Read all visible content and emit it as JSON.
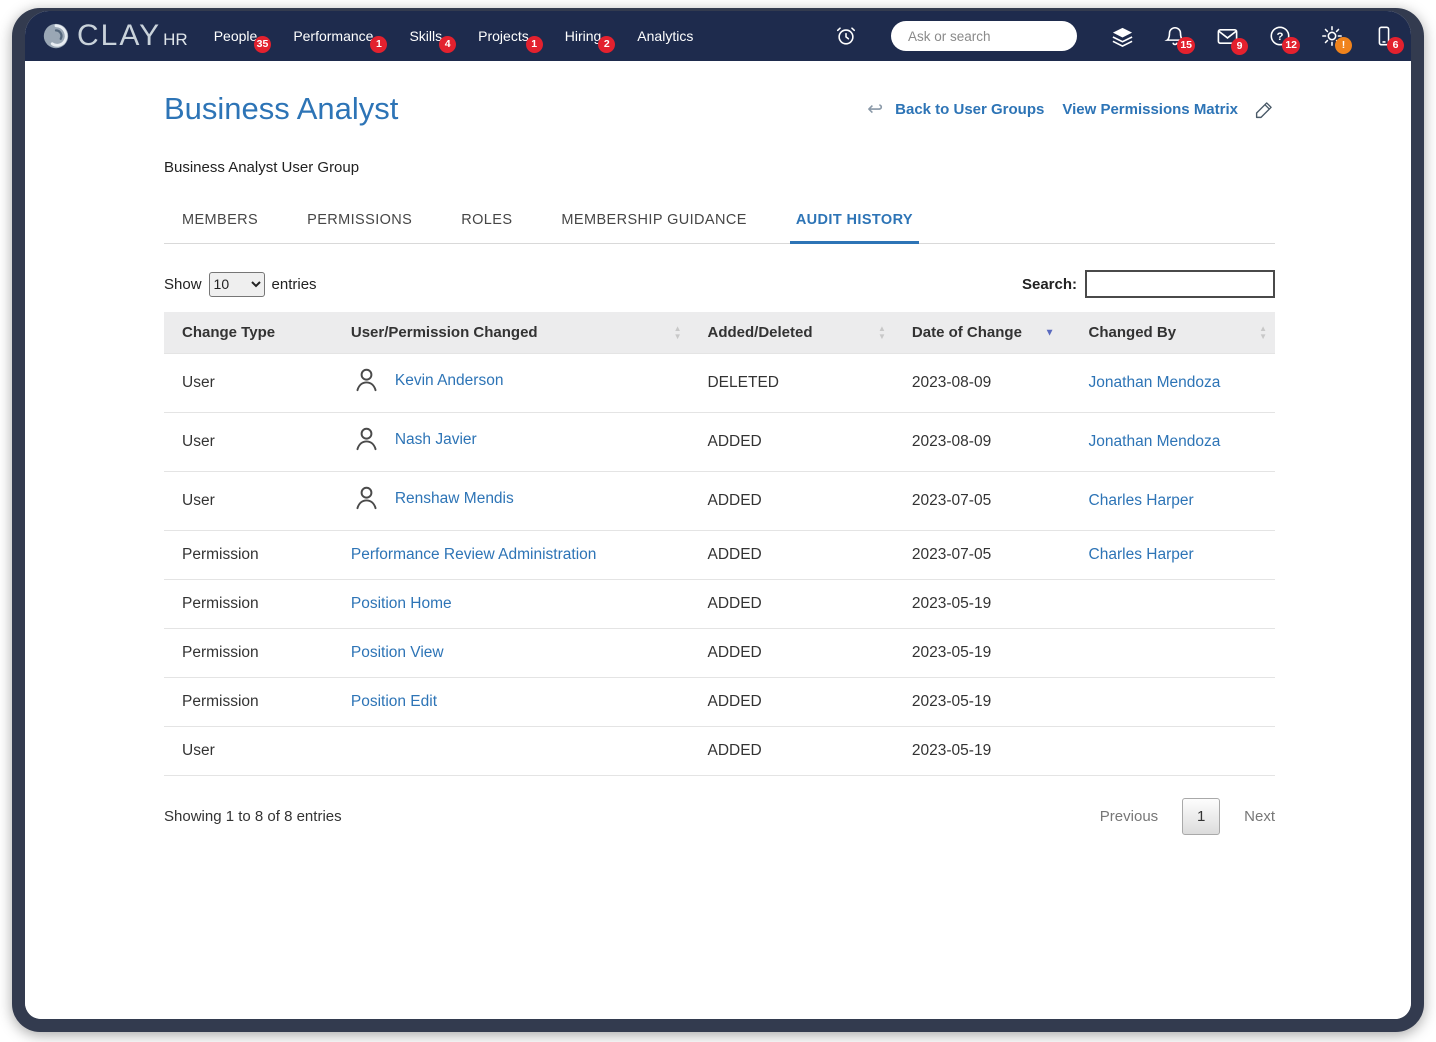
{
  "navbar": {
    "brand_primary": "CLAY",
    "brand_secondary": "HR",
    "items": [
      {
        "label": "People",
        "badge": "35"
      },
      {
        "label": "Performance",
        "badge": "1"
      },
      {
        "label": "Skills",
        "badge": "4"
      },
      {
        "label": "Projects",
        "badge": "1"
      },
      {
        "label": "Hiring",
        "badge": "2"
      },
      {
        "label": "Analytics",
        "badge": ""
      }
    ],
    "search": {
      "placeholder": "Ask or search"
    },
    "status_icons": [
      {
        "name": "clock-icon",
        "badge": ""
      },
      {
        "name": "layers-icon",
        "badge": ""
      },
      {
        "name": "bell-icon",
        "badge": "15"
      },
      {
        "name": "mail-icon",
        "badge": "9"
      },
      {
        "name": "help-icon",
        "badge": "12"
      },
      {
        "name": "gear-icon",
        "badge": "!"
      },
      {
        "name": "phone-icon",
        "badge": "6"
      }
    ]
  },
  "header": {
    "title": "Business Analyst",
    "back_link": "Back to User Groups",
    "permissions_link": "View Permissions Matrix",
    "subtitle": "Business Analyst User Group"
  },
  "tabs": [
    {
      "label": "MEMBERS"
    },
    {
      "label": "PERMISSIONS"
    },
    {
      "label": "ROLES"
    },
    {
      "label": "MEMBERSHIP GUIDANCE"
    },
    {
      "label": "AUDIT HISTORY"
    }
  ],
  "controls": {
    "show_label": "Show",
    "entries_per_page": "10",
    "entries_label": "entries",
    "search_label": "Search:",
    "search_value": ""
  },
  "table": {
    "columns": [
      "Change Type",
      "User/Permission Changed",
      "Added/Deleted",
      "Date of Change",
      "Changed By"
    ],
    "rows": [
      {
        "type": "User",
        "name": "Kevin Anderson",
        "action": "DELETED",
        "date": "2023-08-09",
        "by": "Jonathan Mendoza"
      },
      {
        "type": "User",
        "name": "Nash Javier",
        "action": "ADDED",
        "date": "2023-08-09",
        "by": "Jonathan Mendoza"
      },
      {
        "type": "User",
        "name": "Renshaw Mendis",
        "action": "ADDED",
        "date": "2023-07-05",
        "by": "Charles Harper"
      },
      {
        "type": "Permission",
        "name": "Performance Review Administration",
        "action": "ADDED",
        "date": "2023-07-05",
        "by": "Charles Harper"
      },
      {
        "type": "Permission",
        "name": "Position Home",
        "action": "ADDED",
        "date": "2023-05-19",
        "by": ""
      },
      {
        "type": "Permission",
        "name": "Position View",
        "action": "ADDED",
        "date": "2023-05-19",
        "by": ""
      },
      {
        "type": "Permission",
        "name": "Position Edit",
        "action": "ADDED",
        "date": "2023-05-19",
        "by": ""
      },
      {
        "type": "User",
        "name": "",
        "action": "ADDED",
        "date": "2023-05-19",
        "by": ""
      }
    ]
  },
  "pagination": {
    "summary": "Showing 1 to 8 of 8 entries",
    "previous": "Previous",
    "current_page": "1",
    "next": "Next"
  },
  "glyphs": {
    "back_arrow": "↩",
    "sort_up": "▲",
    "sort_down": "▼",
    "sorted_desc": "▼"
  },
  "colors": {
    "navbar": "#1e2b4d",
    "frame": "#333b4f",
    "accent_blue": "#2d74b6",
    "badge_red": "#e3212e",
    "badge_orange": "#f0831c"
  }
}
